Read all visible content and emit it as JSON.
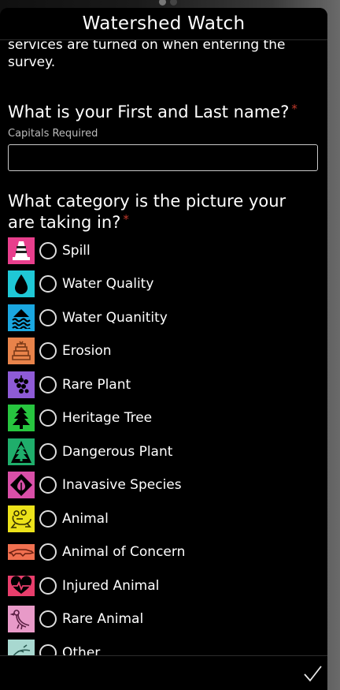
{
  "app": {
    "title": "Watershed Watch"
  },
  "intro_text": "services are turned on when entering the survey.",
  "questions": {
    "name": {
      "label": "What is your First and Last name?",
      "required_mark": "*",
      "hint": "Capitals Required",
      "value": ""
    },
    "category": {
      "label": "What category is the picture your are taking in?",
      "required_mark": "*",
      "options": [
        {
          "label": "Spill",
          "icon": "traffic-cone-icon",
          "color": "#e83e8c"
        },
        {
          "label": "Water Quality",
          "icon": "water-drop-icon",
          "color": "#1fc8d6"
        },
        {
          "label": "Water Quanitity",
          "icon": "water-level-icon",
          "color": "#1aa7e0"
        },
        {
          "label": "Erosion",
          "icon": "erosion-icon",
          "color": "#e8834a"
        },
        {
          "label": "Rare Plant",
          "icon": "berries-icon",
          "color": "#8e5bd6"
        },
        {
          "label": "Heritage Tree",
          "icon": "tree-icon",
          "color": "#27c53f"
        },
        {
          "label": "Dangerous Plant",
          "icon": "tree-warning-icon",
          "color": "#1fae6b"
        },
        {
          "label": "Inavasive Species",
          "icon": "invasive-warning-icon",
          "color": "#d94fa8"
        },
        {
          "label": "Animal",
          "icon": "frog-icon",
          "color": "#ece21a"
        },
        {
          "label": "Animal of Concern",
          "icon": "lizard-icon",
          "color": "#f07050"
        },
        {
          "label": "Injured Animal",
          "icon": "heartbeat-icon",
          "color": "#e83e6c"
        },
        {
          "label": "Rare Animal",
          "icon": "bird-icon",
          "color": "#e89ac8"
        },
        {
          "label": "Other",
          "icon": "other-icon",
          "color": "#a8d8d0"
        }
      ]
    }
  },
  "footer": {
    "submit_icon": "checkmark-icon"
  }
}
